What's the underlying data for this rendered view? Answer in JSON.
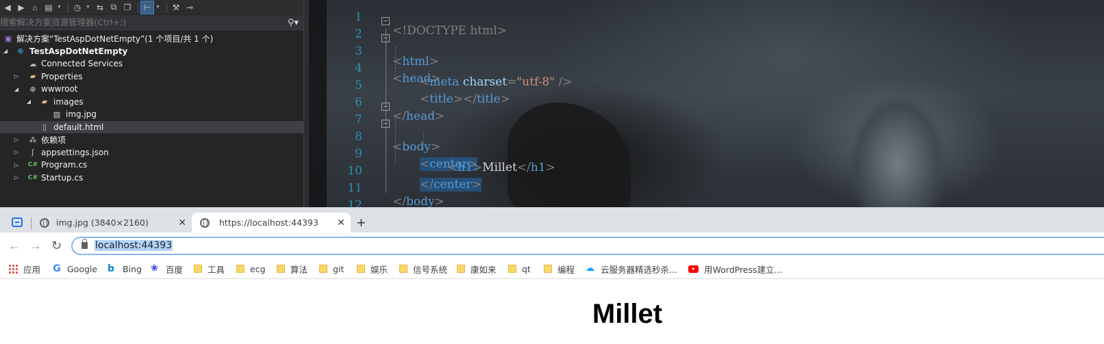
{
  "solution_explorer": {
    "search_placeholder": "搜索解决方案资源管理器(Ctrl+;)",
    "tree": [
      {
        "label": "解决方案“TestAspDotNetEmpty”(1 个项目/共 1 个)",
        "icon": "solution-icon"
      },
      {
        "label": "TestAspDotNetEmpty",
        "icon": "web-project-icon"
      },
      {
        "label": "Connected Services",
        "icon": "connected-services-icon"
      },
      {
        "label": "Properties",
        "icon": "wrench-folder-icon"
      },
      {
        "label": "wwwroot",
        "icon": "globe-icon"
      },
      {
        "label": "images",
        "icon": "folder-icon"
      },
      {
        "label": "img.jpg",
        "icon": "image-file-icon"
      },
      {
        "label": "default.html",
        "icon": "html-file-icon"
      },
      {
        "label": "依赖项",
        "icon": "dependencies-icon"
      },
      {
        "label": "appsettings.json",
        "icon": "json-file-icon"
      },
      {
        "label": "Program.cs",
        "icon": "csharp-file-icon"
      },
      {
        "label": "Startup.cs",
        "icon": "csharp-file-icon"
      }
    ]
  },
  "editor": {
    "line_numbers": [
      "1",
      "2",
      "3",
      "4",
      "5",
      "6",
      "7",
      "8",
      "9",
      "10",
      "11",
      "12"
    ],
    "tokens": {
      "doctype": "<!DOCTYPE html>",
      "lt": "<",
      "lt_slash": "</",
      "gt": ">",
      "self_close": " />",
      "html": "html",
      "head": "head",
      "meta": "meta",
      "charset": "charset",
      "eq": "=",
      "charset_value": "\"utf-8\"",
      "title": "title",
      "body": "body",
      "center": "center",
      "h1": "h1",
      "h1_text": "Millet"
    }
  },
  "browser": {
    "tabs": [
      {
        "title": "img.jpg (3840×2160)",
        "close": "✕"
      },
      {
        "title": "https://localhost:44393",
        "close": "✕"
      }
    ],
    "new_tab": "+",
    "url": "localhost:44393",
    "bookmarks": [
      "应用",
      "Google",
      "Bing",
      "百度",
      "工具",
      "ecg",
      "算法",
      "git",
      "娱乐",
      "信号系统",
      "康如来",
      "qt",
      "编程",
      "云服务器精选秒杀...",
      "用WordPress建立..."
    ],
    "page_heading": "Millet"
  }
}
